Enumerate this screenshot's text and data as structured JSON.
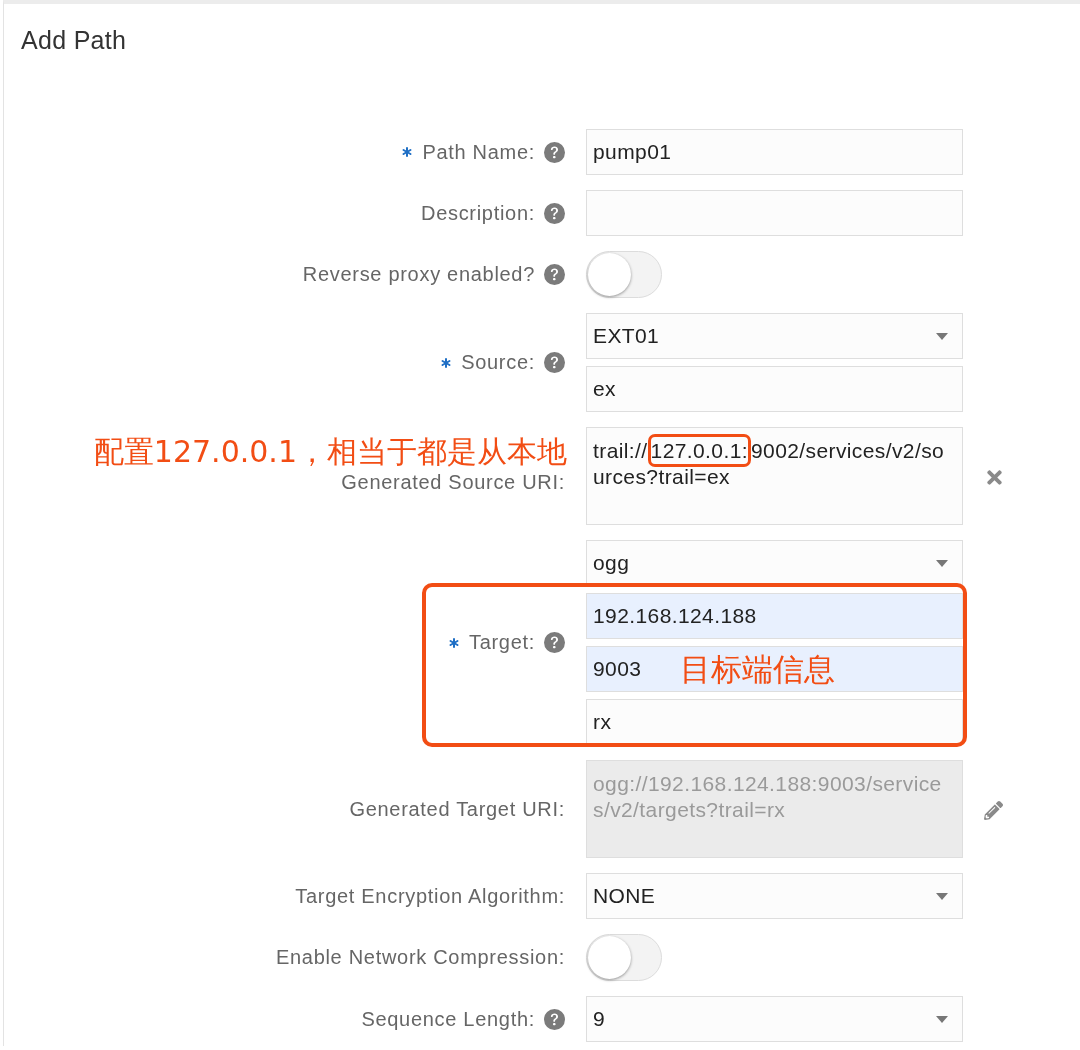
{
  "page": {
    "title": "Add Path"
  },
  "form": {
    "rows": [
      {
        "label": "Path Name:",
        "required": true,
        "help": true,
        "fields": [
          {
            "kind": "text",
            "value": "pump01"
          }
        ]
      },
      {
        "label": "Description:",
        "required": false,
        "help": true,
        "fields": [
          {
            "kind": "text"
          }
        ]
      },
      {
        "label": "Reverse proxy enabled?",
        "required": false,
        "help": true,
        "fields": [
          {
            "kind": "toggle",
            "on": false
          }
        ]
      },
      {
        "label": "Source:",
        "required": true,
        "help": true,
        "fields": [
          {
            "kind": "select",
            "value": "EXT01"
          },
          {
            "kind": "text",
            "value": "ex"
          }
        ]
      },
      {
        "label": "Generated Source URI:",
        "required": false,
        "help": false,
        "note": "配置127.0.0.1，相当于都是从本地",
        "action": {
          "kind": "clear"
        },
        "fields": [
          {
            "kind": "textarea",
            "disabled": false,
            "segments": [
              {
                "text": "trail://",
                "highlighted": false
              },
              {
                "text": "127.0.0.1:",
                "highlighted": true
              },
              {
                "text": "9002/services/v2/sources?trail=ex",
                "highlighted": false
              }
            ]
          }
        ]
      },
      {
        "label": "Target:",
        "required": true,
        "help": true,
        "highlight_box": true,
        "fields": [
          {
            "kind": "select",
            "value": "ogg",
            "autofilled": false
          },
          {
            "kind": "text",
            "value": "192.168.124.188",
            "autofilled": true
          },
          {
            "kind": "text",
            "value": "9003",
            "autofilled": true,
            "note": "目标端信息"
          },
          {
            "kind": "text",
            "value": "rx",
            "autofilled": false
          }
        ]
      },
      {
        "label": "Generated Target URI:",
        "required": false,
        "help": false,
        "action": {
          "kind": "edit"
        },
        "fields": [
          {
            "kind": "textarea",
            "disabled": true,
            "segments": [
              {
                "text": "ogg://192.168.124.188:9003/services/v2/targets?trail=rx",
                "highlighted": false
              }
            ]
          }
        ]
      },
      {
        "label": "Target Encryption Algorithm:",
        "required": false,
        "help": false,
        "fields": [
          {
            "kind": "select",
            "value": "NONE"
          }
        ]
      },
      {
        "label": "Enable Network Compression:",
        "required": false,
        "help": false,
        "fields": [
          {
            "kind": "toggle",
            "on": false
          }
        ]
      },
      {
        "label": "Sequence Length:",
        "required": false,
        "help": true,
        "fields": [
          {
            "kind": "select",
            "value": "9"
          }
        ]
      }
    ]
  }
}
